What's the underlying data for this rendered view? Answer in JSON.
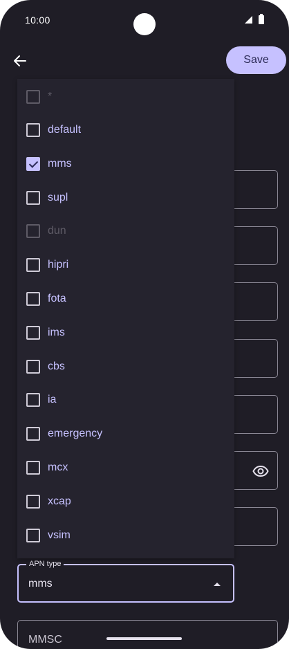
{
  "status_bar": {
    "time": "10:00"
  },
  "app_bar": {
    "back_icon": "arrow-back-icon",
    "save_label": "Save"
  },
  "apn_type_field": {
    "label": "APN type",
    "value": "mms"
  },
  "mmsc_field": {
    "label": "MMSC"
  },
  "menu": {
    "items": [
      {
        "label": "*",
        "checked": false,
        "disabled": true
      },
      {
        "label": "default",
        "checked": false,
        "disabled": false
      },
      {
        "label": "mms",
        "checked": true,
        "disabled": false
      },
      {
        "label": "supl",
        "checked": false,
        "disabled": false
      },
      {
        "label": "dun",
        "checked": false,
        "disabled": true
      },
      {
        "label": "hipri",
        "checked": false,
        "disabled": false
      },
      {
        "label": "fota",
        "checked": false,
        "disabled": false
      },
      {
        "label": "ims",
        "checked": false,
        "disabled": false
      },
      {
        "label": "cbs",
        "checked": false,
        "disabled": false
      },
      {
        "label": "ia",
        "checked": false,
        "disabled": false
      },
      {
        "label": "emergency",
        "checked": false,
        "disabled": false
      },
      {
        "label": "mcx",
        "checked": false,
        "disabled": false
      },
      {
        "label": "xcap",
        "checked": false,
        "disabled": false
      },
      {
        "label": "vsim",
        "checked": false,
        "disabled": false
      }
    ]
  },
  "colors": {
    "background": "#1f1d26",
    "accent": "#c6c1ff",
    "disabled": "#5e5b66"
  }
}
